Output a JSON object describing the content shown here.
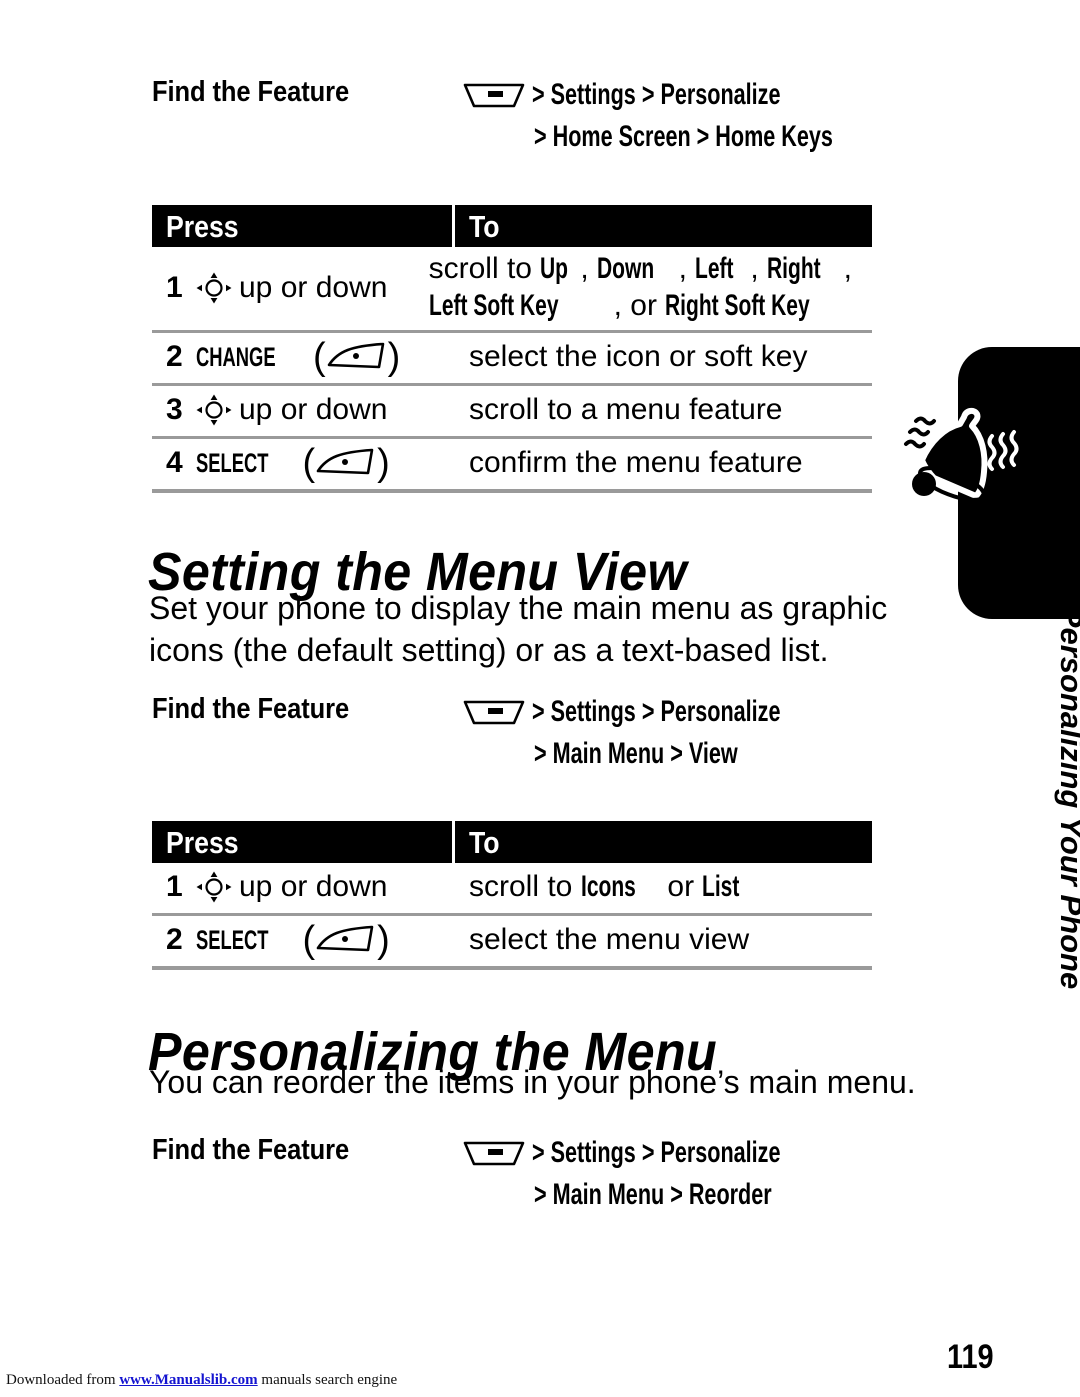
{
  "page": {
    "number": "119",
    "side_tab_title": "Personalizing Your Phone",
    "footer_note_before": "Downloaded from ",
    "footer_link": "www.Manualslib.com",
    "footer_note_after": " manuals search engine",
    "accent_black": "#000000",
    "rule_gray": "#9a9a9a",
    "link_blue": "#1414d0"
  },
  "icons": {
    "menu_key": "menu-key-icon",
    "nav_key": "navigation-key-icon",
    "soft_key": "soft-key-icon",
    "bell": "ringing-bell-icon"
  },
  "section1": {
    "find_label": "Find the Feature",
    "path_line1": "> Settings > Personalize",
    "path_line2": "> Home Screen > Home Keys",
    "table": {
      "col_press": "Press",
      "col_to": "To",
      "rows": [
        {
          "num": "1",
          "press_icon": "nav-key",
          "press_text": "up or down",
          "press_keyname": "",
          "to_line1_pre": "scroll to ",
          "to_line1_b1": "Up",
          "to_line1_s1": ", ",
          "to_line1_b2": "Down",
          "to_line1_s2": ", ",
          "to_line1_b3": "Left",
          "to_line1_s3": ", ",
          "to_line1_b4": "Right",
          "to_line1_s4": ",",
          "to_line2_b1": "Left Soft Key",
          "to_line2_s1": ", or ",
          "to_line2_b2": "Right Soft Key"
        },
        {
          "num": "2",
          "press_keyname": "CHANGE",
          "press_icon": "soft-key",
          "to_line1_pre": "select the icon or soft key"
        },
        {
          "num": "3",
          "press_icon": "nav-key",
          "press_text": "up or down",
          "to_line1_pre": "scroll to a menu feature"
        },
        {
          "num": "4",
          "press_keyname": "SELECT",
          "press_icon": "soft-key",
          "to_line1_pre": "confirm the menu feature"
        }
      ]
    }
  },
  "section2": {
    "heading": "Setting the Menu View",
    "body": "Set your phone to display the main menu as graphic icons (the default setting) or as a text-based list.",
    "find_label": "Find the Feature",
    "path_line1": "> Settings > Personalize",
    "path_line2": "> Main Menu > View",
    "table": {
      "col_press": "Press",
      "col_to": "To",
      "rows": [
        {
          "num": "1",
          "press_icon": "nav-key",
          "press_text": "up or down",
          "to_line1_pre": "scroll to ",
          "to_line1_b1": "Icons",
          "to_line1_s1": " or ",
          "to_line1_b2": "List"
        },
        {
          "num": "2",
          "press_keyname": "SELECT",
          "press_icon": "soft-key",
          "to_line1_pre": "select the menu view"
        }
      ]
    }
  },
  "section3": {
    "heading": "Personalizing the Menu",
    "body": "You can reorder the items in your phone’s main menu.",
    "find_label": "Find the Feature",
    "path_line1": "> Settings > Personalize",
    "path_line2": "> Main Menu > Reorder"
  }
}
